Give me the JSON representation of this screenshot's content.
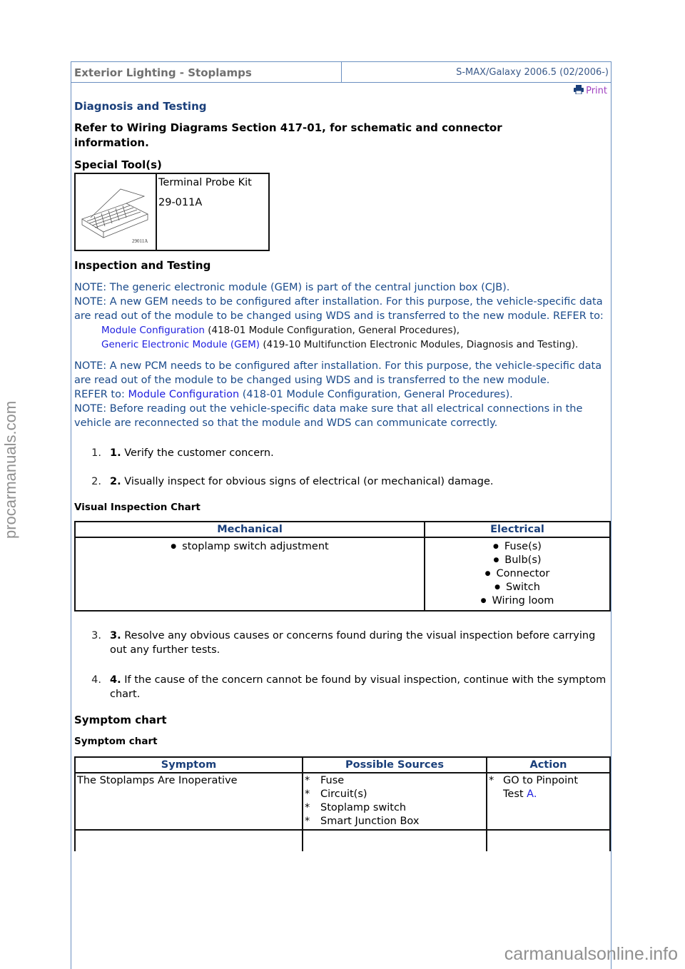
{
  "header": {
    "title": "Exterior Lighting - Stoplamps",
    "model": "S-MAX/Galaxy 2006.5 (02/2006-)"
  },
  "print": {
    "label": "Print",
    "icon": "printer-icon"
  },
  "section_title": "Diagnosis and Testing",
  "wiring_ref": "Refer to Wiring Diagrams Section 417-01, for schematic and connector information.",
  "special_tools": {
    "heading": "Special Tool(s)",
    "image_caption": "29011A",
    "name": "Terminal Probe Kit",
    "number": "29-011A"
  },
  "inspection": {
    "heading": "Inspection and Testing",
    "note1": "NOTE: The generic electronic module (GEM) is part of the central junction box (CJB).",
    "note2": "NOTE: A new GEM needs to be configured after installation. For this purpose, the vehicle-specific data are read out of the module to be changed using WDS and is transferred to the new module. REFER to:",
    "ref1_link": "Module Configuration",
    "ref1_text": " (418-01 Module Configuration, General Procedures),",
    "ref2_link": "Generic Electronic Module (GEM)",
    "ref2_text": " (419-10 Multifunction Electronic Modules, Diagnosis and Testing).",
    "note3": "NOTE: A new PCM needs to be configured after installation. For this purpose, the vehicle-specific data are read out of the module to be changed using WDS and is transferred to the new module.",
    "refer_prefix": "REFER to: ",
    "ref3_link": "Module Configuration",
    "ref3_text": " (418-01 Module Configuration, General Procedures).",
    "note4": "NOTE: Before reading out the vehicle-specific data make sure that all electrical connections in the vehicle are reconnected so that the module and WDS can communicate correctly."
  },
  "steps": [
    {
      "num": "1.",
      "bold": "1.",
      "text": " Verify the customer concern."
    },
    {
      "num": "2.",
      "bold": "2.",
      "text": " Visually inspect for obvious signs of electrical (or mechanical) damage."
    },
    {
      "num": "3.",
      "bold": "3.",
      "text": " Resolve any obvious causes or concerns found during the visual inspection before carrying out any further tests."
    },
    {
      "num": "4.",
      "bold": "4.",
      "text": " If the cause of the concern cannot be found by visual inspection, continue with the symptom chart."
    }
  ],
  "visual_chart": {
    "title": "Visual Inspection Chart",
    "headers": [
      "Mechanical",
      "Electrical"
    ],
    "mechanical": [
      "stoplamp switch adjustment"
    ],
    "electrical": [
      "Fuse(s)",
      "Bulb(s)",
      "Connector",
      "Switch",
      "Wiring loom"
    ]
  },
  "symptom": {
    "heading": "Symptom chart",
    "subheading": "Symptom chart",
    "headers": [
      "Symptom",
      "Possible Sources",
      "Action"
    ],
    "rows": [
      {
        "symptom": "The Stoplamps Are Inoperative",
        "sources": [
          "Fuse",
          "Circuit(s)",
          "Stoplamp switch",
          "Smart Junction Box"
        ],
        "action_text": "GO to Pinpoint Test ",
        "action_link": "A."
      }
    ]
  },
  "watermarks": {
    "left": "procarmanuals.com",
    "bottom": "carmanualsonline.info"
  }
}
